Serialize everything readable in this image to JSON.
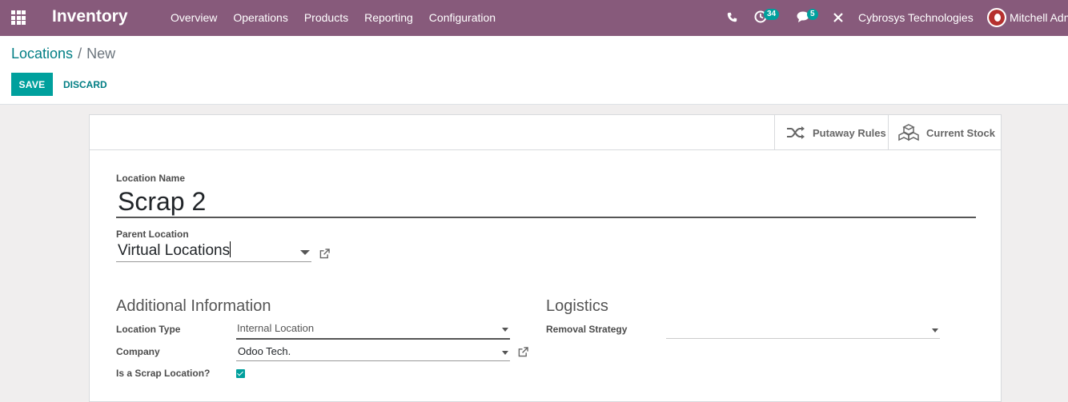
{
  "navbar": {
    "apps_icon": "grid-icon",
    "brand": "Inventory",
    "menu": [
      "Overview",
      "Operations",
      "Products",
      "Reporting",
      "Configuration"
    ],
    "activity_count": "34",
    "messages_count": "5",
    "company": "Cybrosys Technologies",
    "user": "Mitchell Adm"
  },
  "breadcrumb": {
    "parent": "Locations",
    "separator": "/",
    "current": "New"
  },
  "buttons": {
    "save": "SAVE",
    "discard": "DISCARD"
  },
  "smart_buttons": {
    "putaway": "Putaway Rules",
    "stock": "Current Stock"
  },
  "form": {
    "location_name_label": "Location Name",
    "location_name": "Scrap 2",
    "parent_location_label": "Parent Location",
    "parent_location": "Virtual Locations",
    "additional_info_title": "Additional Information",
    "location_type_label": "Location Type",
    "location_type": "Internal Location",
    "company_label": "Company",
    "company": "Odoo Tech.",
    "scrap_label": "Is a Scrap Location?",
    "scrap_checked": true,
    "logistics_title": "Logistics",
    "removal_strategy_label": "Removal Strategy",
    "removal_strategy": ""
  },
  "colors": {
    "navbar": "#875a7b",
    "accent": "#00a09d",
    "link": "#017e84"
  }
}
